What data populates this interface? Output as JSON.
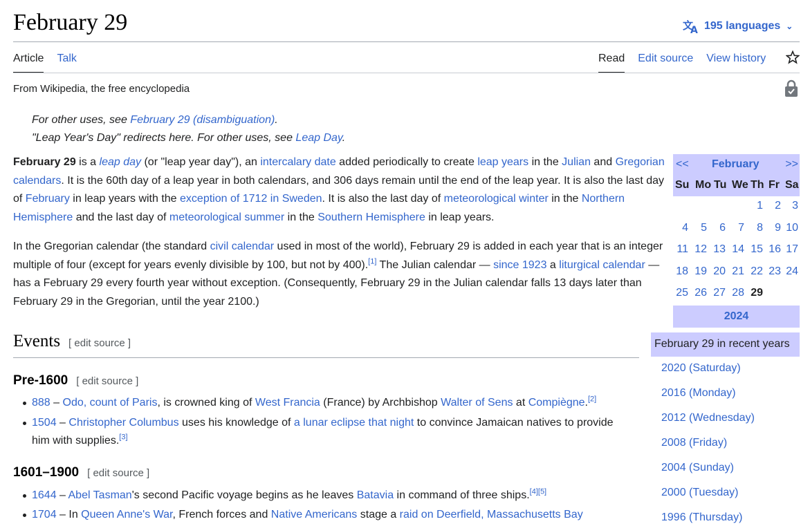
{
  "page": {
    "title": "February 29",
    "languages": "195 languages",
    "tagline": "From Wikipedia, the free encyclopedia"
  },
  "tabs": {
    "left": [
      "Article",
      "Talk"
    ],
    "right": [
      "Read",
      "Edit source",
      "View history"
    ]
  },
  "hatnotes": {
    "line1_pre": "For other uses, see ",
    "line1_link": "February 29 (disambiguation)",
    "line1_post": ".",
    "line2_pre": "\"Leap Year's Day\" redirects here. For other uses, see ",
    "line2_link": "Leap Day",
    "line2_post": "."
  },
  "intro": {
    "p1": [
      {
        "t": "February 29",
        "b": true
      },
      {
        "t": " is a "
      },
      {
        "t": "leap day",
        "l": true,
        "i": true
      },
      {
        "t": " (or \"leap year day\"), an "
      },
      {
        "t": "intercalary date",
        "l": true
      },
      {
        "t": " added periodically to create "
      },
      {
        "t": "leap years",
        "l": true
      },
      {
        "t": " in the "
      },
      {
        "t": "Julian",
        "l": true
      },
      {
        "t": " and "
      },
      {
        "t": "Gregorian calendars",
        "l": true
      },
      {
        "t": ". It is the 60th day of a leap year in both calendars, and 306 days remain until the end of the leap year. It is also the last day of "
      },
      {
        "t": "February",
        "l": true
      },
      {
        "t": " in leap years with the "
      },
      {
        "t": "exception of 1712 in Sweden",
        "l": true
      },
      {
        "t": ". It is also the last day of "
      },
      {
        "t": "meteorological winter",
        "l": true
      },
      {
        "t": " in the "
      },
      {
        "t": "Northern Hemisphere",
        "l": true
      },
      {
        "t": " and the last day of "
      },
      {
        "t": "meteorological summer",
        "l": true
      },
      {
        "t": " in the "
      },
      {
        "t": "Southern Hemisphere",
        "l": true
      },
      {
        "t": " in leap years."
      }
    ],
    "p2": [
      {
        "t": "In the Gregorian calendar (the standard "
      },
      {
        "t": "civil calendar",
        "l": true
      },
      {
        "t": " used in most of the world), February 29 is added in each year that is an integer multiple of four (except for years evenly divisible by 100, but not by 400)."
      },
      {
        "t": "[1]",
        "l": true,
        "s": true
      },
      {
        "t": " The Julian calendar — "
      },
      {
        "t": "since 1923",
        "l": true
      },
      {
        "t": " a "
      },
      {
        "t": "liturgical calendar",
        "l": true
      },
      {
        "t": " — has a February 29 every fourth year without exception. (Consequently, February 29 in the Julian calendar falls 13 days later than February 29 in the Gregorian, until the year 2100.)"
      }
    ]
  },
  "events": {
    "heading": "Events",
    "edit_source": "[ edit source ]",
    "sub1": "Pre-1600",
    "sub2": "1601–1900",
    "items_pre1600": [
      [
        {
          "t": "888",
          "l": true
        },
        {
          "t": " – "
        },
        {
          "t": "Odo, count of Paris",
          "l": true
        },
        {
          "t": ", is crowned king of "
        },
        {
          "t": "West Francia",
          "l": true
        },
        {
          "t": " (France) by Archbishop "
        },
        {
          "t": "Walter of Sens",
          "l": true
        },
        {
          "t": " at "
        },
        {
          "t": "Compiègne",
          "l": true
        },
        {
          "t": "."
        },
        {
          "t": "[2]",
          "l": true,
          "s": true
        }
      ],
      [
        {
          "t": "1504",
          "l": true
        },
        {
          "t": " – "
        },
        {
          "t": "Christopher Columbus",
          "l": true
        },
        {
          "t": " uses his knowledge of "
        },
        {
          "t": "a lunar eclipse that night",
          "l": true
        },
        {
          "t": " to convince Jamaican natives to provide him with supplies."
        },
        {
          "t": "[3]",
          "l": true,
          "s": true
        }
      ]
    ],
    "items_1601": [
      [
        {
          "t": "1644",
          "l": true
        },
        {
          "t": " – "
        },
        {
          "t": "Abel Tasman",
          "l": true
        },
        {
          "t": "'s second Pacific voyage begins as he leaves "
        },
        {
          "t": "Batavia",
          "l": true
        },
        {
          "t": " in command of three ships."
        },
        {
          "t": "[4][5]",
          "l": true,
          "s": true
        }
      ],
      [
        {
          "t": "1704",
          "l": true
        },
        {
          "t": " – In "
        },
        {
          "t": "Queen Anne's War",
          "l": true
        },
        {
          "t": ", French forces and "
        },
        {
          "t": "Native Americans",
          "l": true
        },
        {
          "t": " stage a "
        },
        {
          "t": "raid on Deerfield, Massachusetts Bay",
          "l": true
        }
      ]
    ]
  },
  "calendar": {
    "prev": "<<",
    "month": "February",
    "next": ">>",
    "weekdays": [
      "Su",
      "Mo",
      "Tu",
      "We",
      "Th",
      "Fr",
      "Sa"
    ],
    "weeks": [
      [
        "",
        "",
        "",
        "",
        "1",
        "2",
        "3"
      ],
      [
        "4",
        "5",
        "6",
        "7",
        "8",
        "9",
        "10"
      ],
      [
        "11",
        "12",
        "13",
        "14",
        "15",
        "16",
        "17"
      ],
      [
        "18",
        "19",
        "20",
        "21",
        "22",
        "23",
        "24"
      ],
      [
        "25",
        "26",
        "27",
        "28",
        "29",
        "",
        ""
      ]
    ],
    "today": "29",
    "year": "2024"
  },
  "recent_years": {
    "heading": "February 29 in recent years",
    "items": [
      "2020 (Saturday)",
      "2016 (Monday)",
      "2012 (Wednesday)",
      "2008 (Friday)",
      "2004 (Sunday)",
      "2000 (Tuesday)",
      "1996 (Thursday)"
    ]
  },
  "colors": {
    "link": "#3366cc",
    "calendar_bg": "#ccccff",
    "text": "#202122"
  },
  "icons": [
    "translate-icon",
    "chevron-down-icon",
    "star-icon",
    "lock-icon"
  ]
}
